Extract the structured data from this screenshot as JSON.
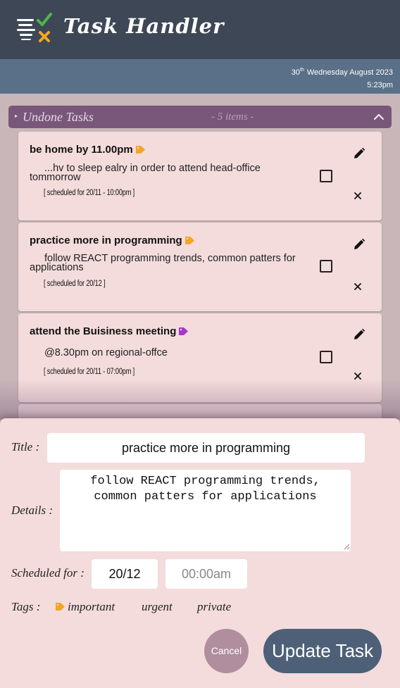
{
  "app": {
    "title": "Task Handler"
  },
  "datebar": {
    "day": "30",
    "day_suffix": "th",
    "date_text": "Wednesday August 2023",
    "time": "5:23pm"
  },
  "section": {
    "title": "Undone Tasks",
    "count": "- 5 items -"
  },
  "tasks": [
    {
      "title": "be home by 11.00pm",
      "tag_color": "#f5a524",
      "detail": "...hv to sleep ealry in order to attend head-office tommorrow",
      "scheduled": "[ scheduled for 20/11 - 10:00pm ]"
    },
    {
      "title": "practice more in programming",
      "tag_color": "#f5a524",
      "detail": "follow REACT programming trends, common patters for applications",
      "scheduled": "[ scheduled for 20/12 ]"
    },
    {
      "title": "attend the Buisiness meeting",
      "tag_color": "#a836c8",
      "detail": "@8.30pm on regional-offce",
      "scheduled": "[ scheduled for 20/11 - 07:00pm ]"
    }
  ],
  "editor": {
    "title_label": "Title :",
    "title_value": "practice more in programming",
    "details_label": "Details :",
    "details_value": "follow REACT programming trends, common patters for applications",
    "scheduled_label": "Scheduled for :",
    "date_value": "20/12",
    "time_placeholder": "00:00am",
    "tags_label": "Tags :",
    "tags": [
      {
        "label": "important",
        "selected": true,
        "color": "#f5a524"
      },
      {
        "label": "urgent",
        "selected": false
      },
      {
        "label": "private",
        "selected": false
      }
    ],
    "cancel_label": "Cancel",
    "update_label": "Update Task"
  },
  "colors": {
    "header": "#3e4756",
    "datebar": "#5a7088",
    "section": "#78577a",
    "card": "#f4dcdc",
    "update_button": "#4d6077",
    "cancel_button": "#b08e9e"
  },
  "icons": [
    "task-logo-icon",
    "tag-icon",
    "chevron-up-icon",
    "edit-pencil-icon",
    "close-icon",
    "checkbox"
  ]
}
